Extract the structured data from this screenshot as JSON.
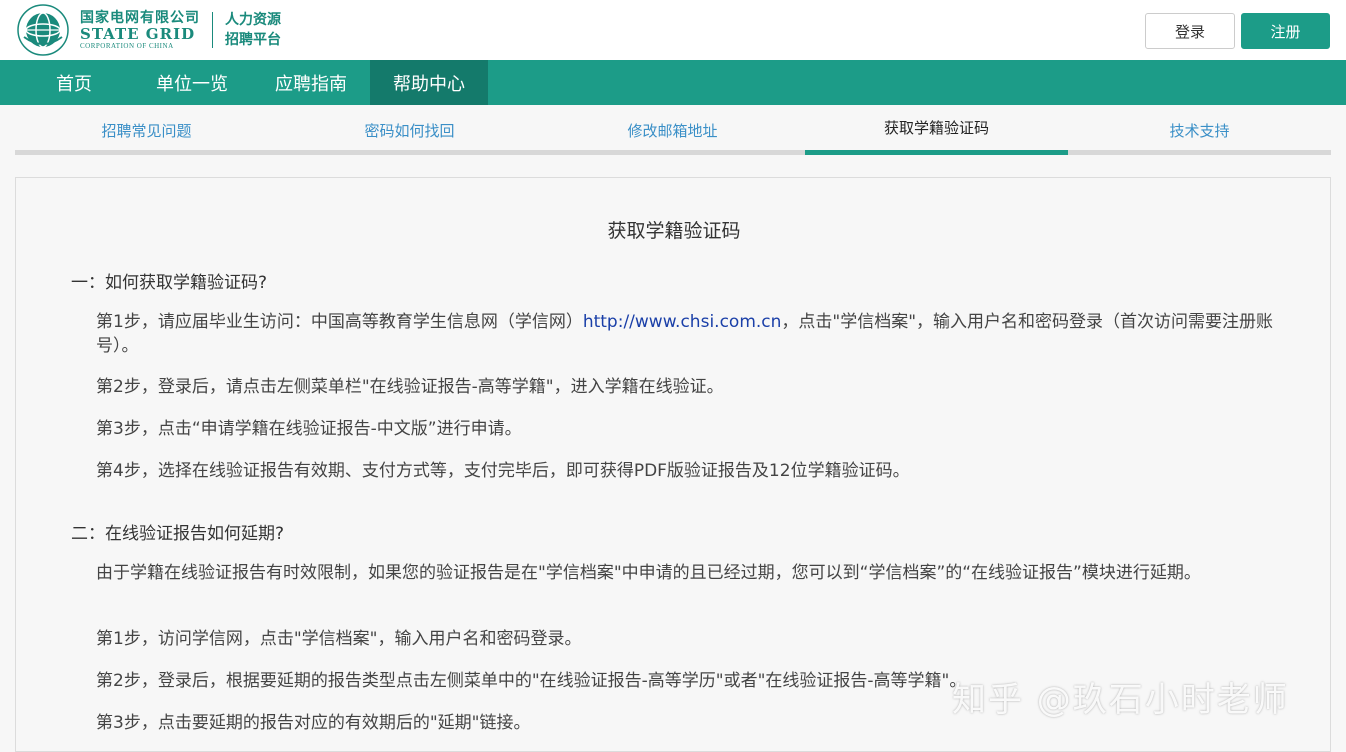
{
  "header": {
    "logo_cn": "国家电网有限公司",
    "logo_en": "STATE GRID",
    "logo_en_sub": "CORPORATION OF CHINA",
    "platform_line1": "人力资源",
    "platform_line2": "招聘平台",
    "login_label": "登录",
    "register_label": "注册"
  },
  "mainnav": {
    "items": [
      {
        "label": "首页"
      },
      {
        "label": "单位一览"
      },
      {
        "label": "应聘指南"
      },
      {
        "label": "帮助中心"
      }
    ],
    "active": "帮助中心"
  },
  "subnav": {
    "items": [
      {
        "label": "招聘常见问题"
      },
      {
        "label": "密码如何找回"
      },
      {
        "label": "修改邮箱地址"
      },
      {
        "label": "获取学籍验证码"
      },
      {
        "label": "技术支持"
      }
    ],
    "active": "获取学籍验证码"
  },
  "content": {
    "title": "获取学籍验证码",
    "section1": {
      "heading": "一：如何获取学籍验证码?",
      "step1_a": "第1步，请应届毕业生访问：中国高等教育学生信息网（学信网）",
      "step1_link": "http://www.chsi.com.cn",
      "step1_b": "，点击\"学信档案\"，输入用户名和密码登录（首次访问需要注册账号）。",
      "step2": "第2步，登录后，请点击左侧菜单栏\"在线验证报告-高等学籍\"，进入学籍在线验证。",
      "step3": "第3步，点击“申请学籍在线验证报告-中文版”进行申请。",
      "step4": "第4步，选择在线验证报告有效期、支付方式等，支付完毕后，即可获得PDF版验证报告及12位学籍验证码。"
    },
    "section2": {
      "heading": "二：在线验证报告如何延期?",
      "intro": "由于学籍在线验证报告有时效限制，如果您的验证报告是在\"学信档案\"中申请的且已经过期，您可以到“学信档案”的“在线验证报告”模块进行延期。",
      "step1": "第1步，访问学信网，点击\"学信档案\"，输入用户名和密码登录。",
      "step2": "第2步，登录后，根据要延期的报告类型点击左侧菜单中的\"在线验证报告-高等学历\"或者\"在线验证报告-高等学籍\"。",
      "step3": "第3步，点击要延期的报告对应的有效期后的\"延期\"链接。"
    }
  },
  "watermark": "知乎 @玖石小时老师",
  "colors": {
    "brand_green": "#1c9c88",
    "nav_active": "#147a6b",
    "link_blue": "#1a3fa8",
    "subnav_link": "#3a8fc7"
  }
}
